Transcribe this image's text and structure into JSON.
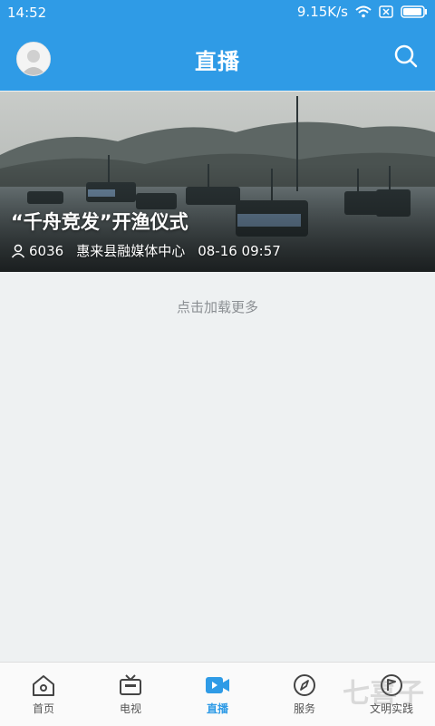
{
  "status_bar": {
    "time": "14:52",
    "network_speed": "9.15K/s"
  },
  "header": {
    "title": "直播"
  },
  "live_card": {
    "title": "“千舟竞发”开渔仪式",
    "viewers": "6036",
    "source": "惠来县融媒体中心",
    "datetime": "08-16 09:57"
  },
  "load_more": "点击加载更多",
  "tabs": [
    {
      "label": "首页",
      "icon": "home-icon"
    },
    {
      "label": "电视",
      "icon": "tv-icon"
    },
    {
      "label": "直播",
      "icon": "live-video-icon",
      "active": true
    },
    {
      "label": "服务",
      "icon": "compass-icon"
    },
    {
      "label": "文明实践",
      "icon": "flag-circle-icon"
    }
  ],
  "colors": {
    "brand_blue": "#2f9be6",
    "background": "#eef1f2"
  },
  "watermark": "七喜子"
}
